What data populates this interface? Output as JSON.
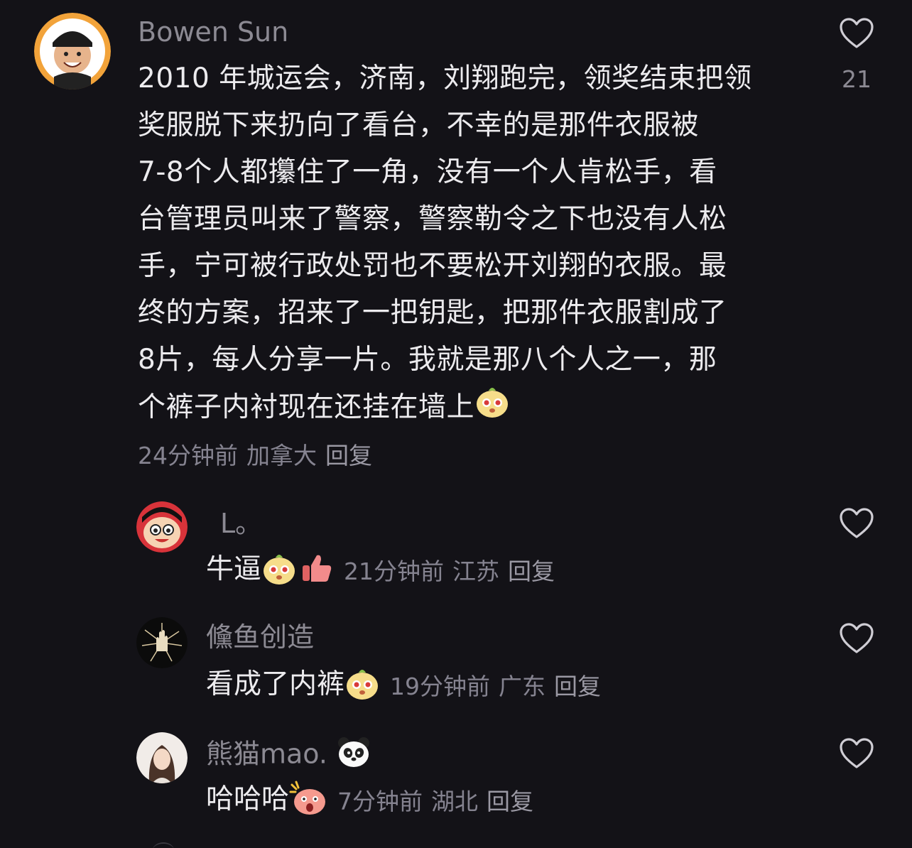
{
  "comment": {
    "username": "Bowen Sun",
    "lines": [
      "2010 年城运会，济南，刘翔跑完，领奖结束把领",
      "奖服脱下来扔向了看台，不幸的是那件衣服被",
      "7-8个人都攥住了一角，没有一个人肯松手，看",
      "台管理员叫来了警察，警察勒令之下也没有人松",
      "手，宁可被行政处罚也不要松开刘翔的衣服。最",
      "终的方案，招来了一把钥匙，把那件衣服割成了",
      " 8片，每人分享一片。我就是那八个人之一，那",
      "个裤子内衬现在还挂在墙上"
    ],
    "time": "24分钟前",
    "location": "加拿大",
    "reply_label": "回复",
    "like_count": "21"
  },
  "replies": [
    {
      "username": "L。",
      "text": "牛逼",
      "time": "21分钟前",
      "location": "江苏",
      "reply_label": "回复"
    },
    {
      "username": "儵鱼创造",
      "text": "看成了内裤",
      "time": "19分钟前",
      "location": "广东",
      "reply_label": "回复"
    },
    {
      "username": "熊猫mao.",
      "text": "哈哈哈",
      "time": "7分钟前",
      "location": "湖北",
      "reply_label": "回复"
    }
  ],
  "icons": {
    "like": "heart-outline-icon",
    "emoji_laugh": "bun-face-emoji",
    "emoji_thumb": "thumbs-up-emoji",
    "emoji_panda": "panda-emoji",
    "emoji_shock": "shocked-face-emoji"
  },
  "colors": {
    "background": "#131217",
    "text_primary": "#ecebee",
    "text_secondary": "#858390"
  }
}
